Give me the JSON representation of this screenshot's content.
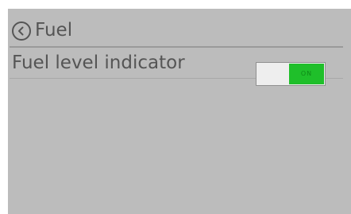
{
  "header": {
    "title": "Fuel",
    "back_icon": "chevron-left-circle-icon"
  },
  "settings": {
    "rows": [
      {
        "label": "Fuel level indicator",
        "toggle": {
          "state_text": "ON",
          "checked": true,
          "on_color": "#1fbf2a"
        }
      }
    ]
  },
  "colors": {
    "panel_background": "#bcbcbc",
    "text": "#555555"
  }
}
